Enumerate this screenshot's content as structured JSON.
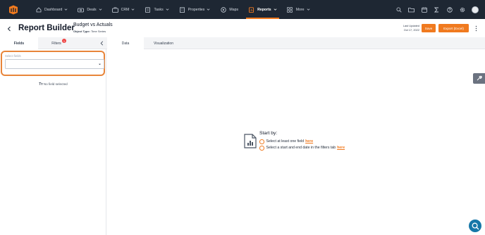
{
  "nav": {
    "items": [
      {
        "label": "Dashboard",
        "icon": "home-icon",
        "has_chevron": true
      },
      {
        "label": "Deals",
        "icon": "deals-icon",
        "has_chevron": true
      },
      {
        "label": "CRM",
        "icon": "crm-icon",
        "has_chevron": true
      },
      {
        "label": "Tasks",
        "icon": "tasks-icon",
        "has_chevron": true
      },
      {
        "label": "Properties",
        "icon": "properties-icon",
        "has_chevron": true
      },
      {
        "label": "Maps",
        "icon": "maps-icon",
        "has_chevron": false
      },
      {
        "label": "Reports",
        "icon": "reports-icon",
        "has_chevron": true,
        "active": true
      },
      {
        "label": "More",
        "icon": "more-icon",
        "has_chevron": true
      }
    ],
    "right_icons": [
      "search-icon",
      "folder-icon",
      "calendar-icon",
      "sigma-icon",
      "help-icon",
      "settings-icon",
      "avatar"
    ]
  },
  "header": {
    "title": "Report Builder",
    "report_name": "Budget vs Actuals",
    "object_type_label": "Object Type:",
    "object_type_value": "Time Series",
    "last_updated_label": "Last Updated",
    "last_updated_date": "Oct 17, 2022",
    "save_label": "Save",
    "export_label": "Export (Excel)"
  },
  "tabs": {
    "fields": "Fields",
    "filters": "Filters",
    "filters_badge": "1",
    "data": "Data",
    "visualization": "Visualization"
  },
  "left_panel": {
    "select_label": "Select fields",
    "select_value": "",
    "no_field_icon": "Tт",
    "no_field_text": "No field selected"
  },
  "main": {
    "start_by": "Start by:",
    "step1_text": "Select at least one field",
    "step1_link": "here",
    "step2_text": "Select a start and end date in the filters tab",
    "step2_link": "here"
  },
  "colors": {
    "accent": "#f07a1f",
    "nav_bg": "#1e2733",
    "highlight": "#e8853a",
    "badge": "#ef4444",
    "help_fab": "#1677a8"
  }
}
